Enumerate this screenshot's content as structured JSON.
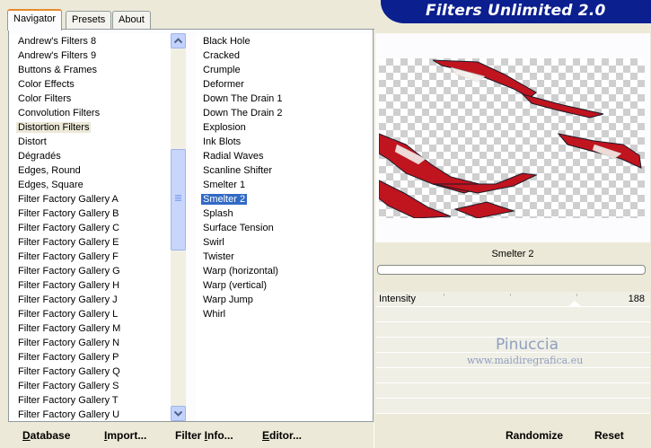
{
  "header": {
    "title": "Filters Unlimited 2.0"
  },
  "tabs": [
    {
      "label": "Navigator",
      "active": true
    },
    {
      "label": "Presets",
      "active": false
    },
    {
      "label": "About",
      "active": false
    }
  ],
  "categories": [
    "Andrew's Filters 8",
    "Andrew's Filters 9",
    "Buttons & Frames",
    "Color Effects",
    "Color Filters",
    "Convolution Filters",
    "Distortion Filters",
    "Distort",
    "Dégradés",
    "Edges, Round",
    "Edges, Square",
    "Filter Factory Gallery A",
    "Filter Factory Gallery B",
    "Filter Factory Gallery C",
    "Filter Factory Gallery E",
    "Filter Factory Gallery F",
    "Filter Factory Gallery G",
    "Filter Factory Gallery H",
    "Filter Factory Gallery J",
    "Filter Factory Gallery L",
    "Filter Factory Gallery M",
    "Filter Factory Gallery N",
    "Filter Factory Gallery P",
    "Filter Factory Gallery Q",
    "Filter Factory Gallery S",
    "Filter Factory Gallery T",
    "Filter Factory Gallery U"
  ],
  "selected_category": "Distortion Filters",
  "filters": [
    "Black Hole",
    "Cracked",
    "Crumple",
    "Deformer",
    "Down The Drain 1",
    "Down The Drain 2",
    "Explosion",
    "Ink Blots",
    "Radial Waves",
    "Scanline Shifter",
    "Smelter 1",
    "Smelter 2",
    "Splash",
    "Surface Tension",
    "Swirl",
    "Twister",
    "Warp (horizontal)",
    "Warp (vertical)",
    "Warp Jump",
    "Whirl"
  ],
  "selected_filter": "Smelter 2",
  "preview": {
    "filter_name": "Smelter 2"
  },
  "parameters": [
    {
      "label": "Intensity",
      "value": "188"
    }
  ],
  "watermark": {
    "name": "Pinuccia",
    "url": "www.maidiregrafica.eu"
  },
  "buttons": {
    "database": {
      "accel": "D",
      "rest": "atabase"
    },
    "import": {
      "accel": "I",
      "rest": "mport..."
    },
    "filter_info": {
      "pre": "Filter ",
      "accel": "I",
      "rest": "nfo..."
    },
    "editor": {
      "accel": "E",
      "rest": "ditor..."
    },
    "randomize": "Randomize",
    "reset": "Reset"
  },
  "colors": {
    "banner": "#0b1f8f",
    "selection": "#316ac5",
    "stain_red": "#c0141e"
  }
}
